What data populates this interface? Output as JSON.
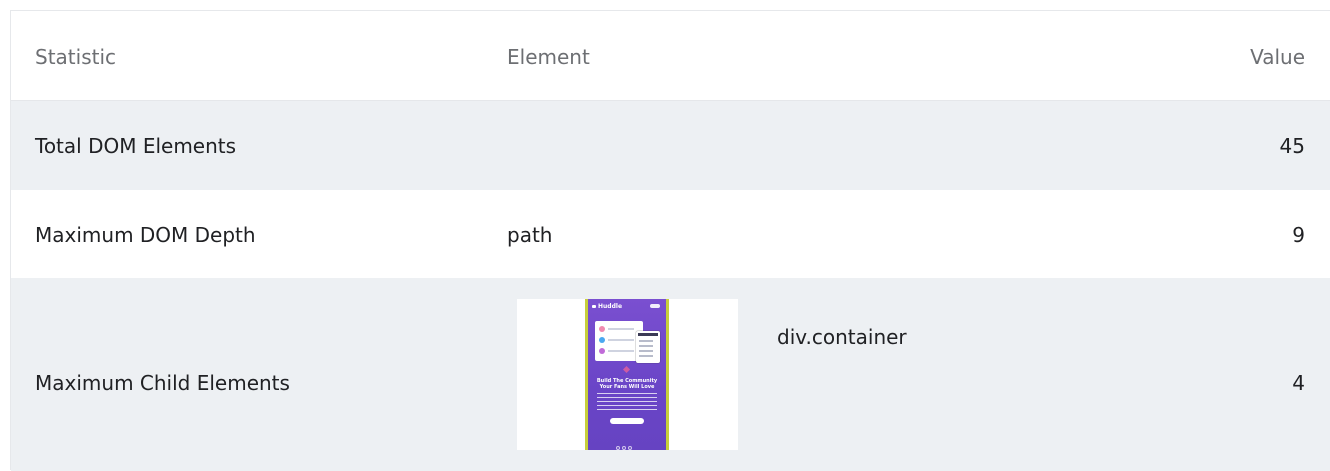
{
  "table": {
    "headers": {
      "statistic": "Statistic",
      "element": "Element",
      "value": "Value"
    },
    "rows": [
      {
        "statistic": "Total DOM Elements",
        "element": "",
        "value": "45"
      },
      {
        "statistic": "Maximum DOM Depth",
        "element": "path",
        "value": "9"
      },
      {
        "statistic": "Maximum Child Elements",
        "element": "div.container",
        "value": "4"
      }
    ]
  },
  "thumbnail": {
    "app_name": "Huddle",
    "headline": "Build The Community Your Fans Will Love",
    "colors": {
      "frame": "#c7cf3b",
      "background": "#6a45c7",
      "accent": "#e5609b"
    }
  },
  "colors": {
    "row_shaded": "#edf0f3",
    "row_plain": "#ffffff",
    "header_text": "#6d6f73",
    "body_text": "#202124"
  }
}
